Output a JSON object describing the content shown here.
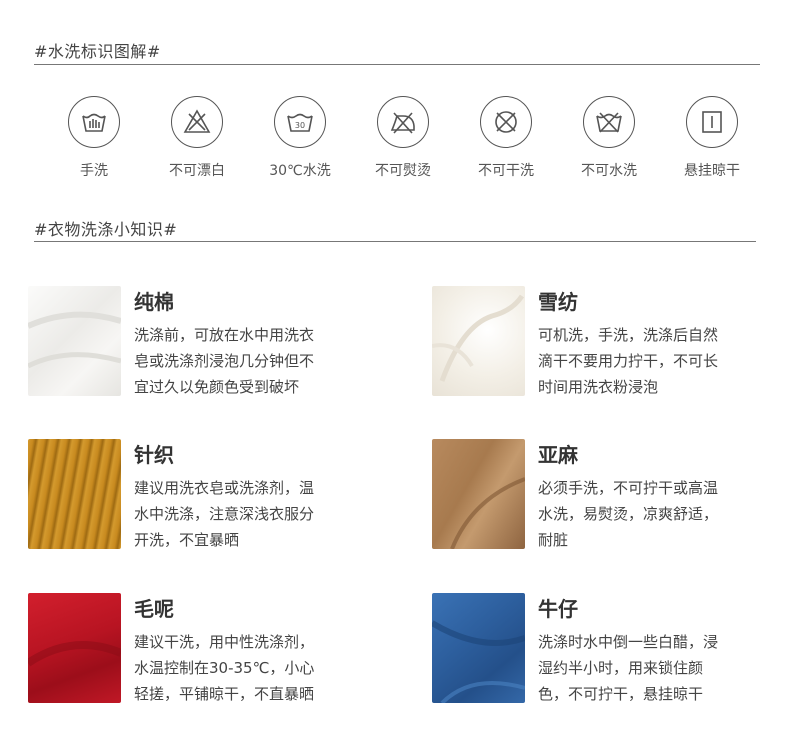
{
  "care_symbols": {
    "title": "#水洗标识图解#",
    "items": [
      {
        "icon": "hand-wash-icon",
        "label": "手洗"
      },
      {
        "icon": "no-bleach-icon",
        "label": "不可漂白"
      },
      {
        "icon": "wash-30-icon",
        "label": "30℃水洗",
        "temp": "30"
      },
      {
        "icon": "no-iron-icon",
        "label": "不可熨烫"
      },
      {
        "icon": "no-dry-clean-icon",
        "label": "不可干洗"
      },
      {
        "icon": "no-wash-icon",
        "label": "不可水洗"
      },
      {
        "icon": "hang-dry-icon",
        "label": "悬挂晾干"
      }
    ]
  },
  "laundry_tips": {
    "title": "#衣物洗涤小知识#",
    "fabrics": [
      {
        "name": "纯棉",
        "lines": [
          "洗涤前，可放在水中用洗衣",
          "皂或洗涤剂浸泡几分钟但不",
          "宜过久以免颜色受到破坏"
        ],
        "color": "#f1f0ee"
      },
      {
        "name": "雪纺",
        "lines": [
          "可机洗，手洗，洗涤后自然",
          "滴干不要用力拧干，不可长",
          "时间用洗衣粉浸泡"
        ],
        "color": "#f4f1ea"
      },
      {
        "name": "针织",
        "lines": [
          "建议用洗衣皂或洗涤剂，温",
          "水中洗涤，注意深浅衣服分",
          "开洗，不宜暴晒"
        ],
        "color": "#c68a22"
      },
      {
        "name": "亚麻",
        "lines": [
          "必须手洗，不可拧干或高温",
          "水洗，易熨烫，凉爽舒适，",
          "耐脏"
        ],
        "color": "#a87a50"
      },
      {
        "name": "毛呢",
        "lines": [
          "建议干洗，用中性洗涤剂，",
          "水温控制在30-35℃，小心",
          "轻搓，平铺晾干，不直暴晒"
        ],
        "color": "#bb1a26"
      },
      {
        "name": "牛仔",
        "lines": [
          "洗涤时水中倒一些白醋，浸",
          "湿约半小时，用来锁住颜",
          "色，不可拧干，悬挂晾干"
        ],
        "color": "#2f63a3"
      }
    ]
  }
}
